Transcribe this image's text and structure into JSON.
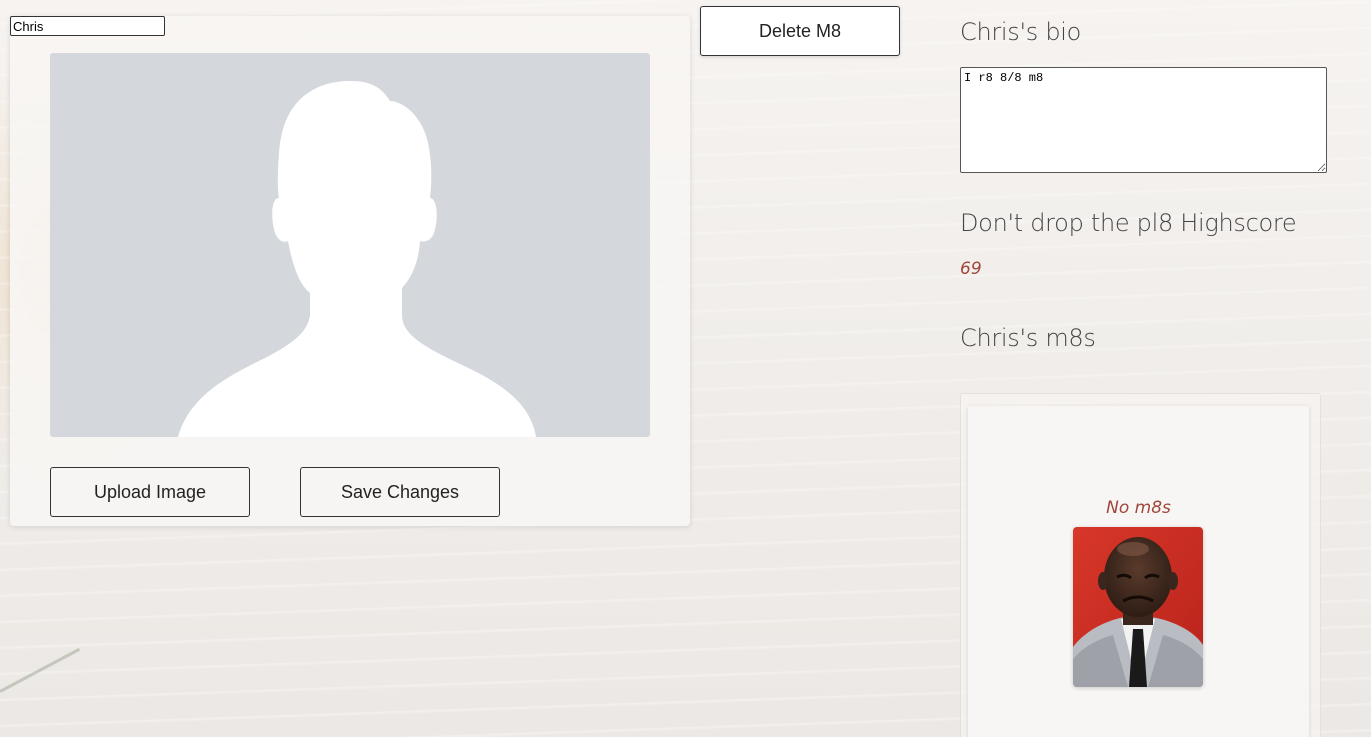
{
  "profile": {
    "name_value": "Chris",
    "upload_label": "Upload Image",
    "save_label": "Save Changes",
    "avatar_icon": "person-silhouette-icon"
  },
  "toolbar": {
    "delete_label": "Delete M8"
  },
  "bio": {
    "heading": "Chris's bio",
    "text": "I r8 8/8 m8"
  },
  "highscore": {
    "heading": "Don't drop the pl8 Highscore",
    "value": "69"
  },
  "m8s": {
    "heading": "Chris's m8s",
    "empty_text": "No m8s"
  },
  "colors": {
    "accent_text": "#a0463a",
    "avatar_bg": "#d4d7dc"
  }
}
